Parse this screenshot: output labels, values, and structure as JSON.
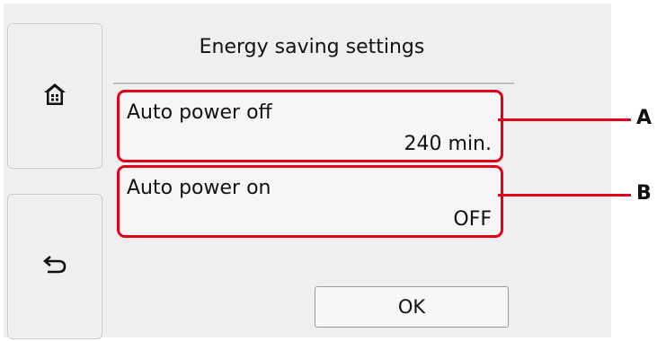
{
  "header": {
    "title": "Energy saving settings"
  },
  "nav": {
    "home_icon": "home-icon",
    "back_icon": "back-arrow-icon"
  },
  "settings": [
    {
      "label": "Auto power off",
      "value": "240 min.",
      "callout": "A"
    },
    {
      "label": "Auto power on",
      "value": "OFF",
      "callout": "B"
    }
  ],
  "actions": {
    "ok_label": "OK"
  },
  "colors": {
    "callout_red": "#e2001a",
    "screen_bg": "#efefef"
  }
}
